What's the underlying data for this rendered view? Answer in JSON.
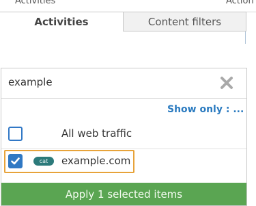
{
  "background_table": {
    "columns": [
      "Activities",
      "Action"
    ]
  },
  "tabs": [
    {
      "label": "Activities",
      "active": true
    },
    {
      "label": "Content filters",
      "active": false
    }
  ],
  "search": {
    "value": "example",
    "placeholder": ""
  },
  "show_only_label": "Show only : ...",
  "items": [
    {
      "label": "All web traffic",
      "checked": false,
      "badge": ""
    },
    {
      "label": "example.com",
      "checked": true,
      "badge": "cat"
    }
  ],
  "apply_button_label": "Apply 1 selected items",
  "colors": {
    "accent_blue": "#2f78c4",
    "apply_green": "#5aa552",
    "highlight_orange": "#e7a33a",
    "badge_teal": "#2c7a7b"
  },
  "icons": {
    "clear": "close-icon",
    "check": "checkmark-icon"
  }
}
